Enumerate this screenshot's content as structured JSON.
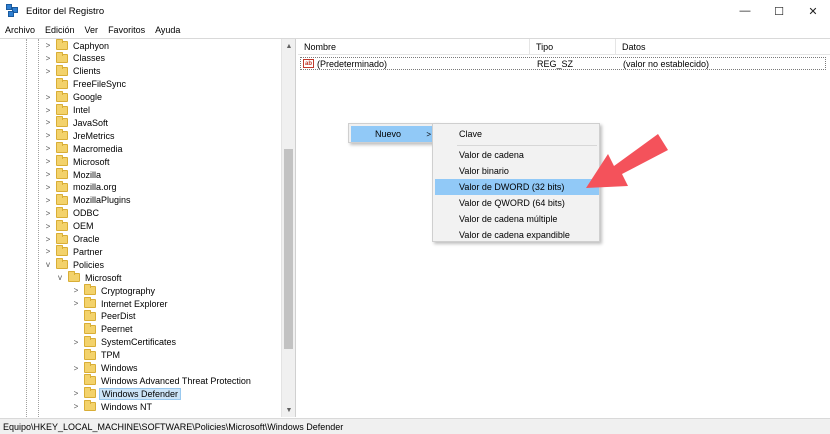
{
  "window": {
    "title": "Editor del Registro",
    "controls": {
      "minimize": "—",
      "maximize": "☐",
      "close": "✕"
    }
  },
  "menu": [
    "Archivo",
    "Edición",
    "Ver",
    "Favoritos",
    "Ayuda"
  ],
  "tree": {
    "items": [
      {
        "label": "Caphyon",
        "expander": ">",
        "level": 1
      },
      {
        "label": "Classes",
        "expander": ">",
        "level": 1
      },
      {
        "label": "Clients",
        "expander": ">",
        "level": 1
      },
      {
        "label": "FreeFileSync",
        "expander": "",
        "level": 1
      },
      {
        "label": "Google",
        "expander": ">",
        "level": 1
      },
      {
        "label": "Intel",
        "expander": ">",
        "level": 1
      },
      {
        "label": "JavaSoft",
        "expander": ">",
        "level": 1
      },
      {
        "label": "JreMetrics",
        "expander": ">",
        "level": 1
      },
      {
        "label": "Macromedia",
        "expander": ">",
        "level": 1
      },
      {
        "label": "Microsoft",
        "expander": ">",
        "level": 1
      },
      {
        "label": "Mozilla",
        "expander": ">",
        "level": 1
      },
      {
        "label": "mozilla.org",
        "expander": ">",
        "level": 1
      },
      {
        "label": "MozillaPlugins",
        "expander": ">",
        "level": 1
      },
      {
        "label": "ODBC",
        "expander": ">",
        "level": 1
      },
      {
        "label": "OEM",
        "expander": ">",
        "level": 1
      },
      {
        "label": "Oracle",
        "expander": ">",
        "level": 1
      },
      {
        "label": "Partner",
        "expander": ">",
        "level": 1
      },
      {
        "label": "Policies",
        "expander": "v",
        "level": 1
      },
      {
        "label": "Microsoft",
        "expander": "v",
        "level": 2
      },
      {
        "label": "Cryptography",
        "expander": ">",
        "level": 3
      },
      {
        "label": "Internet Explorer",
        "expander": ">",
        "level": 3
      },
      {
        "label": "PeerDist",
        "expander": "",
        "level": 3
      },
      {
        "label": "Peernet",
        "expander": "",
        "level": 3
      },
      {
        "label": "SystemCertificates",
        "expander": ">",
        "level": 3
      },
      {
        "label": "TPM",
        "expander": "",
        "level": 3
      },
      {
        "label": "Windows",
        "expander": ">",
        "level": 3
      },
      {
        "label": "Windows Advanced Threat Protection",
        "expander": "",
        "level": 3
      },
      {
        "label": "Windows Defender",
        "expander": ">",
        "level": 3,
        "selected": true
      },
      {
        "label": "Windows NT",
        "expander": ">",
        "level": 3
      }
    ],
    "scroll_up": "▲",
    "scroll_down": "▼"
  },
  "list": {
    "columns": [
      "Nombre",
      "Tipo",
      "Datos"
    ],
    "rows": [
      {
        "icon": "ab",
        "name": "(Predeterminado)",
        "type": "REG_SZ",
        "data": "(valor no establecido)"
      }
    ]
  },
  "context_menu": {
    "nuevo": {
      "label": "Nuevo",
      "arrow": ">"
    },
    "submenu": [
      "Clave",
      "Valor de cadena",
      "Valor binario",
      "Valor de DWORD (32 bits)",
      "Valor de QWORD (64 bits)",
      "Valor de cadena múltiple",
      "Valor de cadena expandible"
    ],
    "highlighted_index": 3
  },
  "annotation": {
    "arrow_color": "#f4525b"
  },
  "status": {
    "path": "Equipo\\HKEY_LOCAL_MACHINE\\SOFTWARE\\Policies\\Microsoft\\Windows Defender"
  }
}
